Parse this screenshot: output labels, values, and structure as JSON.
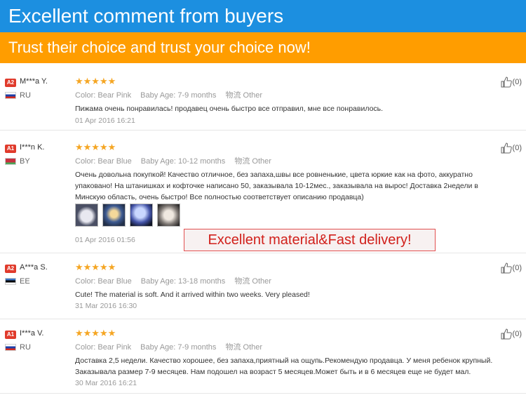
{
  "banner": {
    "title": "Excellent comment from buyers",
    "subtitle": "Trust their choice and trust your choice now!"
  },
  "callout": "Excellent material&Fast delivery!",
  "colors": {
    "banner_blue": "#1c8fe0",
    "banner_orange": "#ff9d00",
    "star": "#f5a623",
    "level_badge": "#e03b2c",
    "callout_red": "#d1201b"
  },
  "reviews": [
    {
      "level": "A2",
      "user": "M***a Y.",
      "country": "RU",
      "flag": "russia-flag-icon",
      "stars": "★★★★★",
      "color_label": "Color:",
      "color_value": "Bear Pink",
      "age_label": "Baby Age:",
      "age_value": "7-9 months",
      "ship_label": "物流",
      "ship_value": "Other",
      "text": "Пижама очень понравилась! продавец очень быстро все отправил, мне все понравилось.",
      "date": "01 Apr 2016 16:21",
      "likes": "(0)"
    },
    {
      "level": "A1",
      "user": "I***n K.",
      "country": "BY",
      "flag": "belarus-flag-icon",
      "stars": "★★★★★",
      "color_label": "Color:",
      "color_value": "Bear Blue",
      "age_label": "Baby Age:",
      "age_value": "10-12 months",
      "ship_label": "物流",
      "ship_value": "Other",
      "text": "Очень довольна покупкой! Качество отличное, без запаха,швы все ровненькие, цвета юркие как на фото, аккуратно упаковано! На штанишках и кофточке написано 50, заказывала 10-12мес., заказывала на вырос! Доставка 2недели в Минскую область, очень быстро! Все полностью соответствует описанию продавца)",
      "date": "01 Apr 2016 01:56",
      "likes": "(0)"
    },
    {
      "level": "A2",
      "user": "A***a S.",
      "country": "EE",
      "flag": "estonia-flag-icon",
      "stars": "★★★★★",
      "color_label": "Color:",
      "color_value": "Bear Blue",
      "age_label": "Baby Age:",
      "age_value": "13-18 months",
      "ship_label": "物流",
      "ship_value": "Other",
      "text": "Cute! The material is soft. And it arrived within two weeks. Very pleased!",
      "date": "31 Mar 2016 16:30",
      "likes": "(0)"
    },
    {
      "level": "A1",
      "user": "I***a V.",
      "country": "RU",
      "flag": "russia-flag-icon",
      "stars": "★★★★★",
      "color_label": "Color:",
      "color_value": "Bear Pink",
      "age_label": "Baby Age:",
      "age_value": "7-9 months",
      "ship_label": "物流",
      "ship_value": "Other",
      "text": "Доставка 2,5 недели. Качество хорошее, без запаха,приятный на ощупь.Рекомендую продавца. У меня ребенок крупный. Заказывала размер 7-9 месяцев. Нам подошел на возраст 5 месяцев.Может быть и в 6 месяцев еще не будет мал.",
      "date": "30 Mar 2016 16:21",
      "likes": "(0)"
    }
  ]
}
